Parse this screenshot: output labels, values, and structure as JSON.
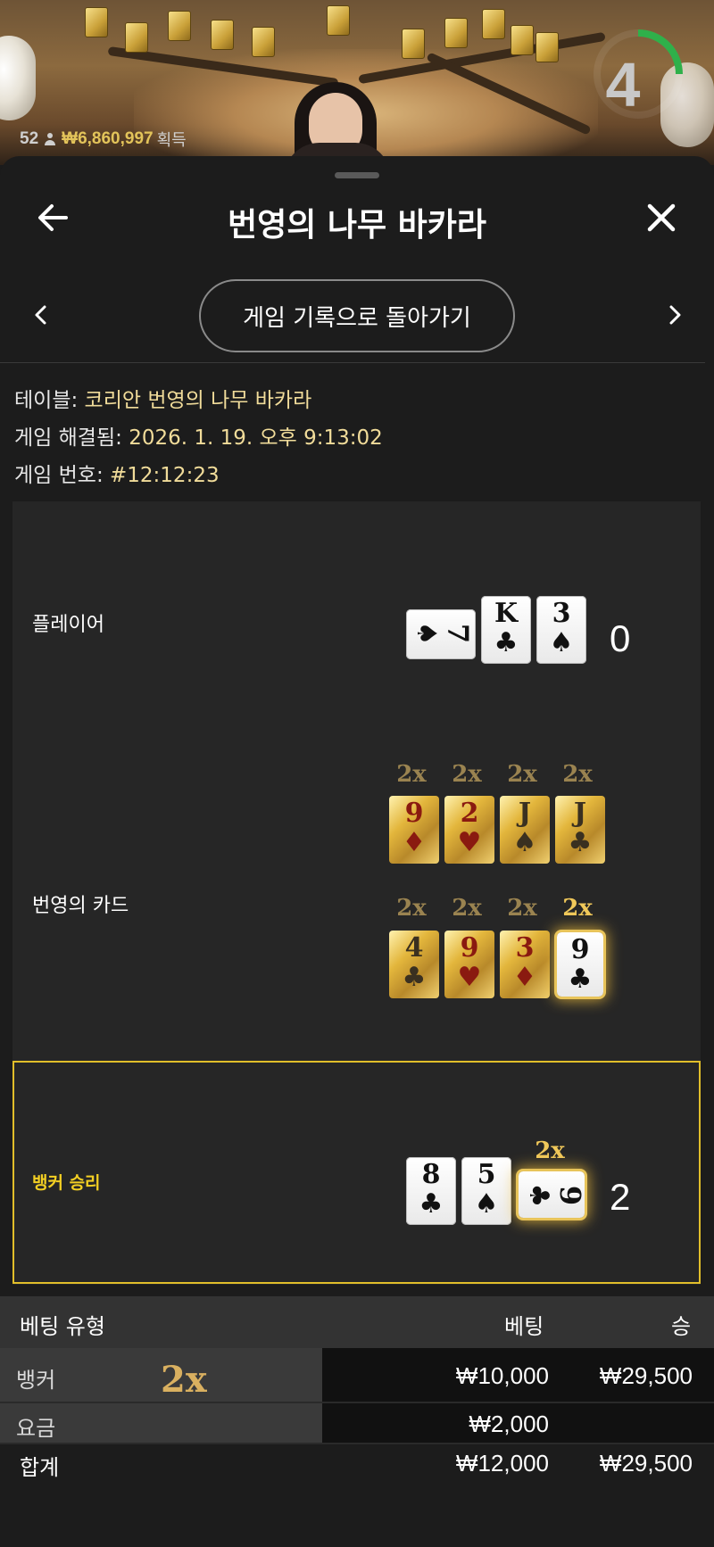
{
  "video": {
    "player_count": "52",
    "total_won": "₩6,860,997",
    "won_label": "획득",
    "countdown": "4",
    "countdown_fraction": 0.25
  },
  "header": {
    "title": "번영의 나무 바카라",
    "history_button": "게임 기록으로 돌아가기"
  },
  "info": {
    "table_label": "테이블:",
    "table_value": "코리안 번영의 나무 바카라",
    "resolved_label": "게임 해결됨:",
    "resolved_value": "2026. 1. 19. 오후 9:13:02",
    "game_no_label": "게임 번호:",
    "game_no_value": "#12:12:23"
  },
  "result": {
    "player": {
      "label": "플레이어",
      "score": "0",
      "cards": [
        {
          "rank": "7",
          "suit": "♠",
          "sideways": true
        },
        {
          "rank": "K",
          "suit": "♣",
          "sideways": false
        },
        {
          "rank": "3",
          "suit": "♠",
          "sideways": false
        }
      ]
    },
    "lucky": {
      "label": "번영의 카드",
      "row1": [
        {
          "mult": "2x",
          "rank": "9",
          "suit": "♦",
          "color": "red"
        },
        {
          "mult": "2x",
          "rank": "2",
          "suit": "♥",
          "color": "red"
        },
        {
          "mult": "2x",
          "rank": "J",
          "suit": "♠",
          "color": "black"
        },
        {
          "mult": "2x",
          "rank": "J",
          "suit": "♣",
          "color": "black"
        }
      ],
      "row2": [
        {
          "mult": "2x",
          "rank": "4",
          "suit": "♣",
          "color": "black"
        },
        {
          "mult": "2x",
          "rank": "9",
          "suit": "♥",
          "color": "red"
        },
        {
          "mult": "2x",
          "rank": "3",
          "suit": "♦",
          "color": "red"
        },
        {
          "mult": "2x",
          "rank": "9",
          "suit": "♣",
          "color": "black",
          "matched": true
        }
      ]
    },
    "banker": {
      "label": "뱅커 승리",
      "score": "2",
      "third_card_mult": "2x",
      "cards": [
        {
          "rank": "8",
          "suit": "♣",
          "sideways": false
        },
        {
          "rank": "5",
          "suit": "♠",
          "sideways": false
        },
        {
          "rank": "9",
          "suit": "♣",
          "sideways": true
        }
      ]
    }
  },
  "bets": {
    "headers": {
      "type": "베팅 유형",
      "bet": "베팅",
      "win": "승"
    },
    "rows": [
      {
        "type": "뱅커",
        "multiplier": "2x",
        "bet": "₩10,000",
        "win": "₩29,500"
      },
      {
        "type": "요금",
        "bet": "₩2,000",
        "win": ""
      }
    ],
    "total": {
      "type": "합계",
      "bet": "₩12,000",
      "win": "₩29,500"
    }
  },
  "colors": {
    "accent_gold": "#e3c45a",
    "banker_highlight": "#e1be2a",
    "timer_green": "#2fb04a"
  }
}
